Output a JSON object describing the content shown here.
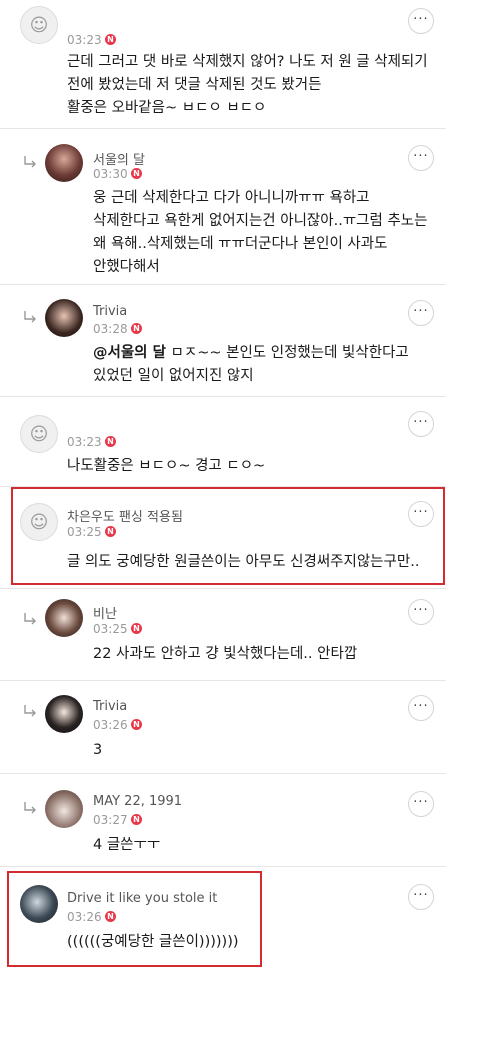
{
  "comments": [
    {
      "nickname": "",
      "time": "03:23",
      "badge": "N",
      "body": "근데 그러고 댓 바로 삭제했지 않어? 나도 저 원 글 삭제되기\n전에 봤었는데 저 댓글 삭제된 것도 봤거든\n활중은 오바같음~ ㅂㄷㅇ ㅂㄷㅇ"
    },
    {
      "nickname": "서울의 달",
      "time": "03:30",
      "badge": "N",
      "body": "웅 근데 삭제한다고 다가 아니니까ㅠㅠ 욕하고\n삭제한다고 욕한게 없어지는건 아니잖아..ㅠ그럼 추노는\n왜 욕해..삭제했는데 ㅠㅠ더군다나 본인이 사과도\n안했다해서"
    },
    {
      "nickname": "Trivia",
      "time": "03:28",
      "badge": "N",
      "mention": "@서울의 달",
      "body": " ㅁㅈ~~ 본인도 인정했는데 빛삭한다고\n있었던 일이 없어지진 않지"
    },
    {
      "nickname": "",
      "time": "03:23",
      "badge": "N",
      "body": "나도활중은 ㅂㄷㅇ~ 경고 ㄷㅇ~"
    },
    {
      "nickname": "차은우도 팬싱 적용됨",
      "time": "03:25",
      "badge": "N",
      "body": "글 의도 궁예당한 원글쓴이는 아무도 신경써주지않는구만.."
    },
    {
      "nickname": "비난",
      "time": "03:25",
      "badge": "N",
      "body": "22 사과도 안하고 걍 빛삭했다는데.. 안타깝"
    },
    {
      "nickname": "Trivia",
      "time": "03:26",
      "badge": "N",
      "body": "3"
    },
    {
      "nickname": "MAY 22, 1991",
      "time": "03:27",
      "badge": "N",
      "body": "4 글쓴ㅜㅜ"
    },
    {
      "nickname": "Drive it like you stole it",
      "time": "03:26",
      "badge": "N",
      "body": "((((((궁예당한 글쓴이)))))))"
    }
  ],
  "more_label": "···",
  "colors": {
    "highlight": "#d42b31",
    "badge": "#e8374a"
  }
}
